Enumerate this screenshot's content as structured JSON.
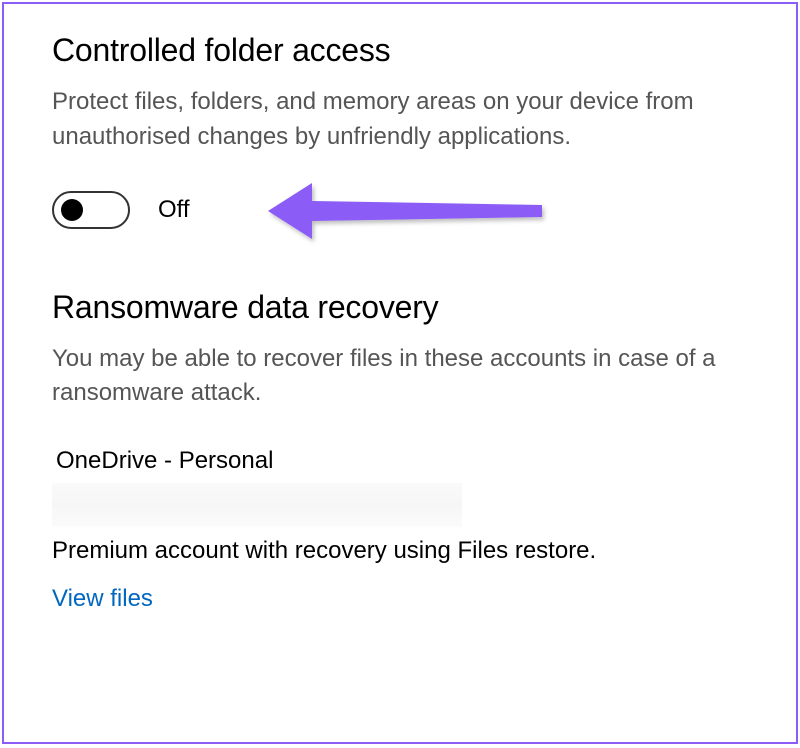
{
  "sections": {
    "controlled_folder_access": {
      "heading": "Controlled folder access",
      "description": "Protect files, folders, and memory areas on your device from unauthorised changes by unfriendly applications.",
      "toggle": {
        "state_label": "Off",
        "value": false
      }
    },
    "ransomware_data_recovery": {
      "heading": "Ransomware data recovery",
      "description": "You may be able to recover files in these accounts in case of a ransomware attack.",
      "account": {
        "name": "OneDrive - Personal",
        "detail": "Premium account with recovery using Files restore.",
        "link_label": "View files"
      }
    }
  },
  "annotation": {
    "arrow_color": "#8b5cf6"
  }
}
